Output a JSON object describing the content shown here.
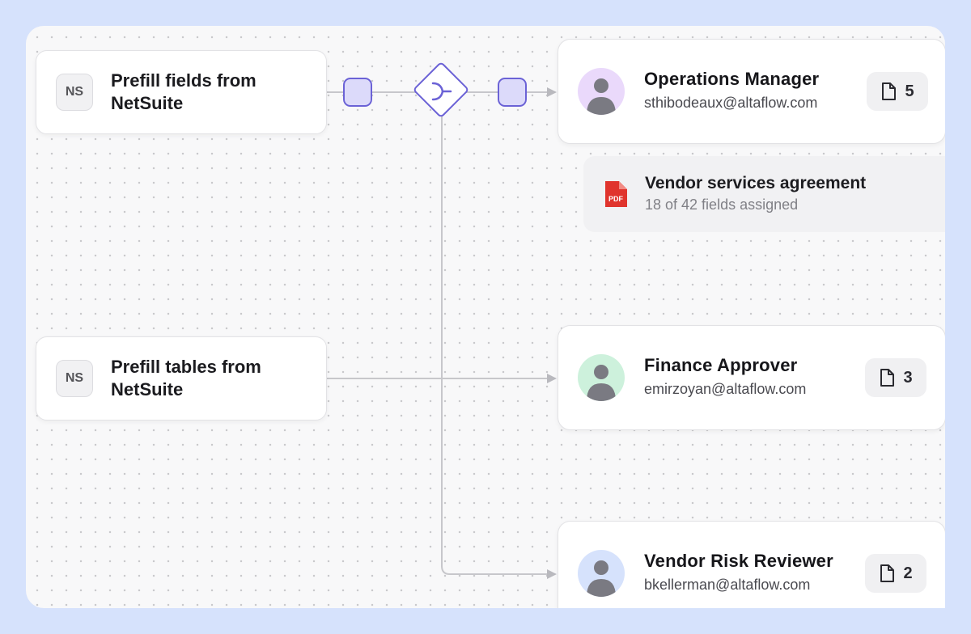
{
  "sources": [
    {
      "badge": "NS",
      "title": "Prefill fields from NetSuite"
    },
    {
      "badge": "NS",
      "title": "Prefill tables from NetSuite"
    }
  ],
  "roles": [
    {
      "name": "Operations Manager",
      "email": "sthibodeaux@altaflow.com",
      "doc_count": "5",
      "avatar_color": "#ead9fb"
    },
    {
      "name": "Finance Approver",
      "email": "emirzoyan@altaflow.com",
      "doc_count": "3",
      "avatar_color": "#cdf1dc"
    },
    {
      "name": "Vendor Risk Reviewer",
      "email": "bkellerman@altaflow.com",
      "doc_count": "2",
      "avatar_color": "#d6e2fc"
    }
  ],
  "document": {
    "icon_label": "PDF",
    "title": "Vendor services agreement",
    "subtitle": "18 of 42 fields assigned"
  },
  "icons": {
    "source": "netsuite-badge-icon",
    "connector": "rounded-square-node-icon",
    "merge": "merge-diamond-icon",
    "avatar": "user-avatar-icon",
    "doc": "document-icon",
    "pdf": "pdf-file-icon"
  },
  "colors": {
    "background": "#d6e2fc",
    "accent": "#6b62d6",
    "connector_fill": "#dcdafa",
    "pdf_red": "#e0342d"
  }
}
